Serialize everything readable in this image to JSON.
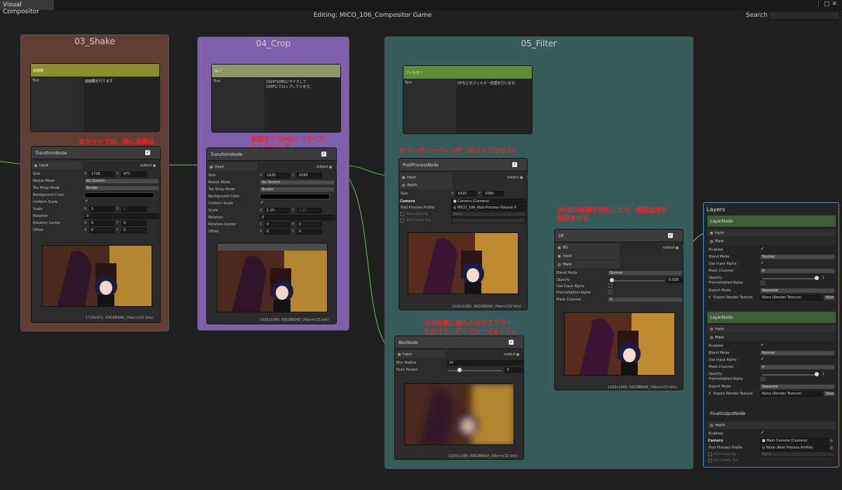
{
  "window": {
    "tab": "Visual Compositor",
    "editing": "Editing: MICO_106_Compositor Game",
    "search_label": "Search:"
  },
  "colors": {
    "shake_group": "#5f3e34",
    "crop_group": "#7e60ad",
    "filter_group": "#355b5b",
    "note_red": "#ff1f1f",
    "wire_green": "#5cc85c"
  },
  "groups": {
    "shake": "03_Shake",
    "crop": "04_Crop",
    "filter": "05_Filter"
  },
  "sticky": {
    "shake": {
      "title": "画面動",
      "field": "Text",
      "body": "画面動を行ります"
    },
    "crop": {
      "title": "ｸﾛｯﾌﾟ",
      "field": "Text",
      "body": "1920*1080にサイズして\n100Fにクロップしています。"
    },
    "filter": {
      "title": "フィルター",
      "field": "Text",
      "body": "DFなどのフィルター処理を行います。"
    }
  },
  "notes": {
    "shake": "本カットでは、特に指揮は\nなし",
    "crop": "画面をフルHDにリサイズ\nしてクロップ",
    "post": "カラーグレーディング（ポストプロセス）",
    "df": "DF的な処理を挟むことで、画面全体を\n馴染ませる",
    "blur": "元の画像に強めのガウスブラー\nをかけて、ディフュージョンフィ\nルタの準備"
  },
  "transform1": {
    "title": "TransformNode",
    "input": "Input",
    "output": "output",
    "size_label": "Size",
    "size_x": "1728",
    "size_y": "972",
    "resize_label": "Resize Mode",
    "resize": "No Stretch",
    "wrap_label": "Tex Wrap Mode",
    "wrap": "Border",
    "bg_label": "Background Color",
    "uniform_label": "Uniform Scale",
    "scale_label": "Scale",
    "scale_x": "1",
    "scale_y": "1",
    "rot_label": "Rotation",
    "rot": "0",
    "rotc_label": "Rotation Center",
    "rotc_x": "0",
    "rotc_y": "0",
    "offset_label": "Offset",
    "offset_x": "0",
    "offset_y": "0",
    "footer": "1728x972, R8G8B8A8_UNorm(32 bits)"
  },
  "transform2": {
    "title": "TransformNode",
    "input": "Input",
    "output": "output",
    "size_label": "Size",
    "size_x": "1920",
    "size_y": "1080",
    "resize_label": "Resize Mode",
    "resize": "No Stretch",
    "wrap_label": "Tex Wrap Mode",
    "wrap": "Border",
    "bg_label": "Background Color",
    "uniform_label": "Uniform Scale",
    "scale_label": "Scale",
    "scale_x": "1.25",
    "scale_y": "1.25",
    "rot_label": "Rotation",
    "rot": "0",
    "rotc_label": "Rotation Center",
    "rotc_x": "0",
    "rotc_y": "0",
    "offset_label": "Offset",
    "offset_x": "0",
    "offset_y": "0",
    "footer": "1920x1080, R8G8B8A8_UNorm(32 bits)"
  },
  "post": {
    "title": "PostProcessNode",
    "input": "Input",
    "depth": "depth",
    "output": "output",
    "size_label": "Size",
    "size_x": "1920",
    "size_y": "1080",
    "camera_label": "Camera",
    "camera": "Camera (Camera)",
    "profile_label": "Post Process Profile",
    "profile": "MICO_106_Post-Process Volume P",
    "aa_label": "Anti-aliasing",
    "aa": "None",
    "depth_label": "Set Depth Tex",
    "footer": "1920x1080, R8G8B8A8_UNorm(32 bits)"
  },
  "blur": {
    "title": "BlurNode",
    "input": "Input",
    "output": "output",
    "radius_label": "Blur Radius",
    "radius": "10",
    "passes_label": "Num Passes",
    "passes": "3",
    "footer": "1920x1080, R8G8B8A8_UNorm(32 bits)"
  },
  "df": {
    "title": "DF",
    "bg": "BG",
    "input": "Input",
    "mask": "Mask",
    "output": "output",
    "blend_label": "Blend Mode",
    "blend": "Normal",
    "opacity_label": "Opacity",
    "opacity": "0.029",
    "alpha_label": "Use Input Alpha",
    "premul_label": "Premultiplied Alpha",
    "mask_label": "Mask Channel",
    "mask_ch": "A",
    "footer": "1920x1080, R8G8B8A8_UNorm(32 bits)"
  },
  "layers": {
    "title": "Layers",
    "nodes": [
      {
        "title": "LayerNode",
        "input": "Input",
        "mask": "Mask",
        "enabled": "Enabled",
        "blend_label": "Blend Mode",
        "blend": "Normal",
        "alpha": "Use Input Alpha",
        "mask_ch_label": "Mask Channel",
        "mask_ch": "A",
        "opacity_label": "Opacity",
        "opacity": "1",
        "premul": "Premultiplied Alpha",
        "export_label": "Export Mode",
        "export": "Separate",
        "rt_label": "Export Render Texture",
        "rt": "None (Render Texture)",
        "new": "New"
      },
      {
        "title": "LayerNode",
        "input": "Input",
        "mask": "Mask",
        "enabled": "Enabled",
        "blend_label": "Blend Mode",
        "blend": "Normal",
        "alpha": "Use Input Alpha",
        "mask_ch_label": "Mask Channel",
        "mask_ch": "A",
        "opacity_label": "Opacity",
        "opacity": "1",
        "premul": "Premultiplied Alpha",
        "export_label": "Export Mode",
        "export": "Separate",
        "rt_label": "Export Render Texture",
        "rt": "None (Render Texture)",
        "new": "New"
      }
    ],
    "final": {
      "title": "FinalOutputNode",
      "depth": "depth",
      "enabled": "Enabled",
      "camera_label": "Camera",
      "camera": "Main Camera (Camera)",
      "profile_label": "Post Process Profile",
      "profile": "None (Post Process Profile)",
      "aa_label": "Anti-aliasing",
      "aa": "None",
      "depth_label": "Set Depth Tex"
    }
  }
}
